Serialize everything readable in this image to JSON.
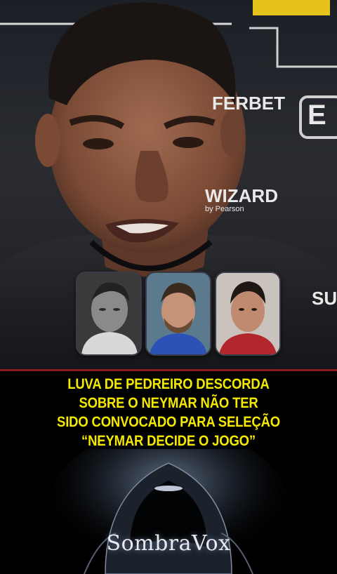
{
  "sponsors": {
    "betting": "FERBET",
    "wizard": "WIZARD",
    "wizard_sub": "by Pearson",
    "side_right": "SU",
    "edge_right": "E"
  },
  "portraits": [
    {
      "name": "neymar-portrait"
    },
    {
      "name": "messi-portrait"
    },
    {
      "name": "ronaldo-portrait"
    }
  ],
  "caption": {
    "lines": [
      "LUVA DE PEDREIRO DESCORDA",
      "SOBRE O NEYMAR NÃO TER",
      "SIDO CONVOCADO PARA SELEÇÃO",
      "“NEYMAR DECIDE O JOGO”"
    ]
  },
  "brand": {
    "name": "SombraVox"
  },
  "colors": {
    "caption": "#f4e900",
    "divider": "#8b1a1a",
    "background": "#000000"
  }
}
